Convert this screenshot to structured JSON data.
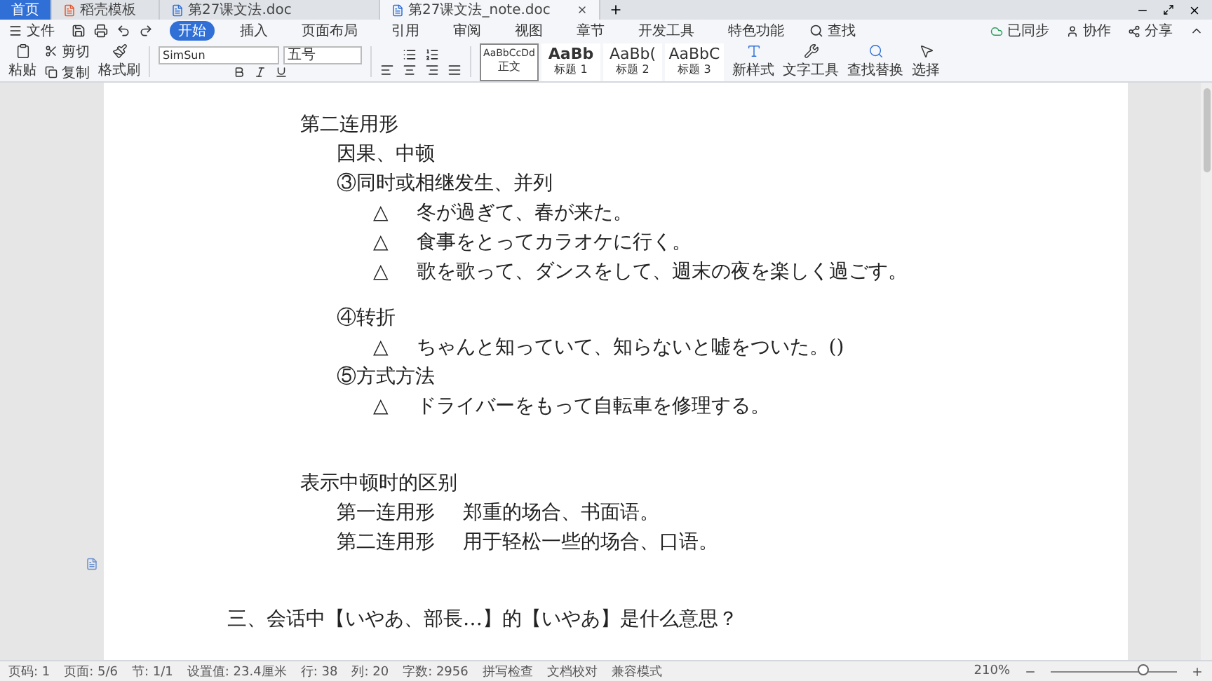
{
  "tabs": [
    {
      "label": "首页",
      "kind": "home",
      "selected": false
    },
    {
      "label": "稻壳模板",
      "kind": "template",
      "selected": false
    },
    {
      "label": "第27课文法.doc",
      "kind": "doc",
      "selected": false
    },
    {
      "label": "第27课文法_note.doc",
      "kind": "doc",
      "selected": true
    }
  ],
  "menu": {
    "file": "文件",
    "items": [
      {
        "label": "开始",
        "selected": true
      },
      {
        "label": "插入",
        "selected": false
      },
      {
        "label": "页面布局",
        "selected": false
      },
      {
        "label": "引用",
        "selected": false
      },
      {
        "label": "审阅",
        "selected": false
      },
      {
        "label": "视图",
        "selected": false
      },
      {
        "label": "章节",
        "selected": false
      },
      {
        "label": "开发工具",
        "selected": false
      },
      {
        "label": "特色功能",
        "selected": false
      }
    ],
    "search": "查找",
    "right": [
      "已同步",
      "协作",
      "分享"
    ]
  },
  "ribbon": {
    "paste": "粘贴",
    "cut": "剪切",
    "copy": "复制",
    "format_painter": "格式刷",
    "font": "SimSun",
    "size": "五号",
    "styles": [
      {
        "preview": "AaBbCcDd",
        "label": "正文",
        "selected": true
      },
      {
        "preview": "AaBb",
        "label": "标题 1",
        "selected": false
      },
      {
        "preview": "AaBb(",
        "label": "标题 2",
        "selected": false
      },
      {
        "preview": "AaBbC",
        "label": "标题 3",
        "selected": false
      }
    ],
    "tools": [
      "新样式",
      "文字工具",
      "查找替换",
      "选择"
    ]
  },
  "document": [
    {
      "text": "第二连用形",
      "children": [
        {
          "text": "因果、中顿"
        },
        {
          "text": "③同时或相继发生、并列",
          "children": [
            {
              "mark": "△",
              "text": "冬が過ぎて、春が来た。"
            },
            {
              "mark": "△",
              "text": "食事をとってカラオケに行く。"
            },
            {
              "mark": "△",
              "text": "歌を歌って、ダンスをして、週末の夜を楽しく過ごす。"
            }
          ]
        },
        {
          "text": "④转折",
          "blank_before": true,
          "children": [
            {
              "mark": "△",
              "text": "ちゃんと知っていて、知らないと嘘をついた。()"
            }
          ]
        },
        {
          "text": "⑤方式方法",
          "children": [
            {
              "mark": "△",
              "text": "ドライバーをもって自転車を修理する。"
            }
          ]
        }
      ]
    },
    {
      "text": "表示中顿时的区别",
      "blank_before": true,
      "children": [
        {
          "term": "第一连用形",
          "text": "郑重的场合、书面语。"
        },
        {
          "term": "第二连用形",
          "text": "用于轻松一些的场合、口语。"
        }
      ]
    },
    {
      "text": "三、会话中【いやあ、部長…】的【いやあ】是什么意思？",
      "kind": "section",
      "blank_before": true
    }
  ],
  "status": [
    "页码: 1",
    "页面: 5/6",
    "节: 1/1",
    "设置值: 23.4厘米",
    "行: 38",
    "列: 20",
    "字数: 2956",
    "拼写检查",
    "文档校对",
    "兼容模式"
  ],
  "zoom": {
    "label": "210%",
    "level": 0.75
  }
}
